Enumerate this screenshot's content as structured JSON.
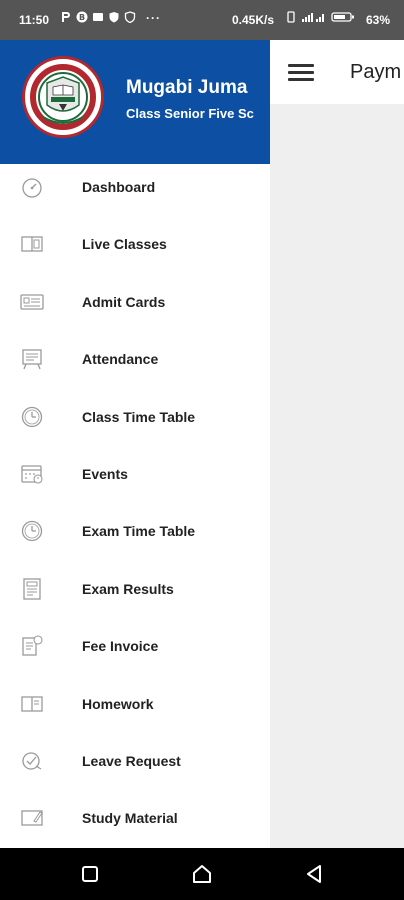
{
  "status_bar": {
    "time": "11:50",
    "left_icons": [
      "p-app-icon",
      "b-app-icon",
      "message-icon",
      "shield-icon",
      "vpn-icon"
    ],
    "more": "···",
    "net_speed": "0.45K/s",
    "right_icons": [
      "vibrate-icon",
      "signal-icon",
      "battery-icon"
    ],
    "battery": "63%"
  },
  "app_bar": {
    "title": "Paym"
  },
  "drawer": {
    "user_name": "Mugabi Juma",
    "user_class": "Class Senior Five Sc",
    "logo": {
      "icon": "school-crest-logo",
      "motto": "TANGI ASUGE",
      "place": "KAGADI"
    },
    "items": [
      {
        "label": "Dashboard",
        "icon": "dashboard-gauge-icon"
      },
      {
        "label": "Live Classes",
        "icon": "live-classes-book-icon"
      },
      {
        "label": "Admit Cards",
        "icon": "admit-card-icon"
      },
      {
        "label": "Attendance",
        "icon": "attendance-board-icon"
      },
      {
        "label": "Class Time Table",
        "icon": "clock-icon"
      },
      {
        "label": "Events",
        "icon": "calendar-icon"
      },
      {
        "label": "Exam Time Table",
        "icon": "clock-icon"
      },
      {
        "label": "Exam Results",
        "icon": "results-sheet-icon"
      },
      {
        "label": "Fee Invoice",
        "icon": "invoice-icon"
      },
      {
        "label": "Homework",
        "icon": "homework-book-icon"
      },
      {
        "label": "Leave Request",
        "icon": "leave-request-icon"
      },
      {
        "label": "Study Material",
        "icon": "study-material-icon"
      }
    ]
  },
  "nav_bar": {
    "buttons": [
      "recents-square-icon",
      "home-circle-icon",
      "back-triangle-icon"
    ]
  },
  "colors": {
    "drawer_header": "#0d4fa3",
    "status_bar": "#555555",
    "nav_bar": "#000000",
    "logo_ring": "#b2282f"
  }
}
